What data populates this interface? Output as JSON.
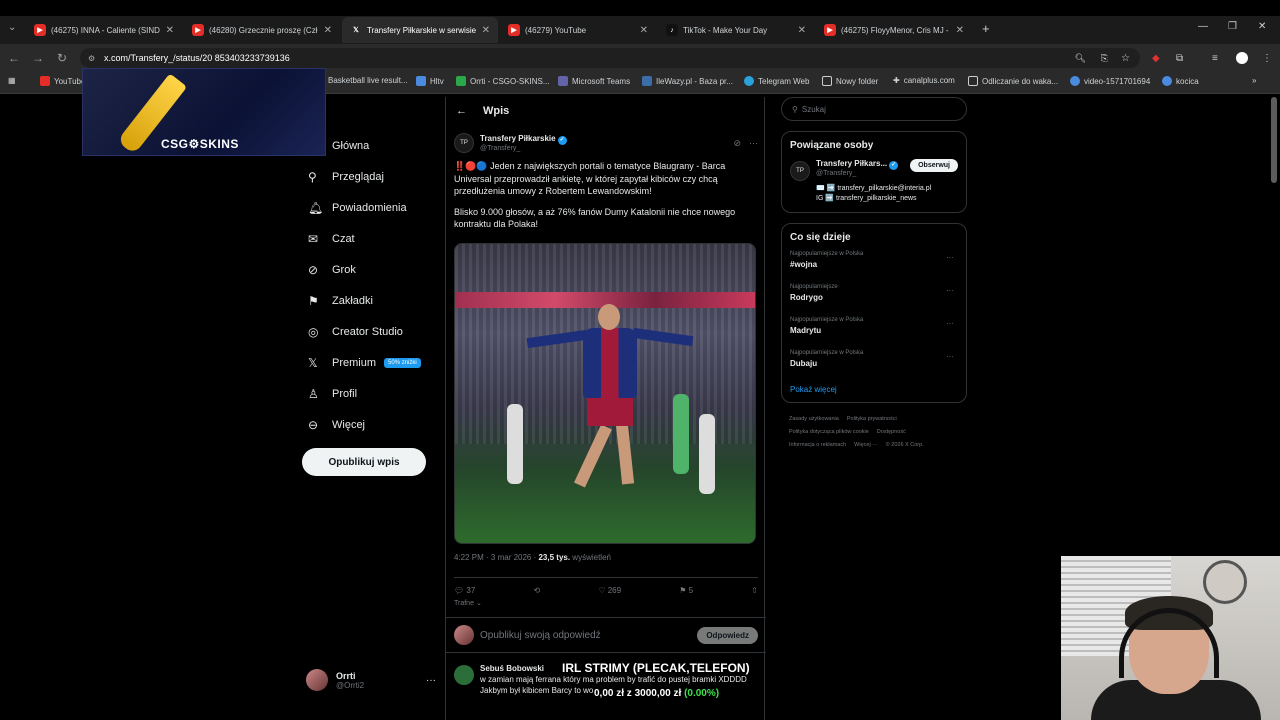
{
  "tabs": [
    {
      "title": "(46275) INNA - Caliente (SINDR",
      "icon": "youtube-icon"
    },
    {
      "title": "(46280) Grzecznie proszę (Człu",
      "icon": "youtube-icon"
    },
    {
      "title": "Transfery Piłkarskie w serwisie X",
      "icon": "x-icon"
    },
    {
      "title": "(46279) YouTube",
      "icon": "youtube-icon"
    },
    {
      "title": "TikTok - Make Your Day",
      "icon": "tiktok-icon"
    },
    {
      "title": "(46275) FloyyMenor, Cris MJ - G",
      "icon": "youtube-icon"
    }
  ],
  "url": "x.com/Transfery_/status/20     853403233739136",
  "bookmarks": [
    "YouTube",
    "Basketball live result...",
    "Hltv",
    "Orrti - CSGO-SKINS...",
    "Microsoft Teams",
    "IleWazy.pl - Baza pr...",
    "Telegram Web",
    "Nowy folder",
    "canalplus.com",
    "Odliczanie do waka...",
    "video-1571701694",
    "kocica"
  ],
  "csg_logo": "CSG⚙SKINS",
  "nav": {
    "items": [
      "Główna",
      "Przeglądaj",
      "Powiadomienia",
      "Czat",
      "Grok",
      "Zakładki",
      "Creator Studio",
      "Premium",
      "Profil",
      "Więcej"
    ],
    "premium_badge": "50% zniżki",
    "post_button": "Opublikuj wpis"
  },
  "user": {
    "name": "Orrti",
    "handle": "@Orrti2"
  },
  "header_title": "Wpis",
  "tweet": {
    "author": "Transfery Piłkarskie",
    "handle": "@Transfery_",
    "text1": "‼️🔴🔵 Jeden z największych portali o tematyce Blaugrany - Barca Universal przeprowadził ankietę, w której zapytał kibiców czy chcą przedłużenia umowy z Robertem Lewandowskim!",
    "text2": "Blisko 9.000 głosów, a aż 76% fanów Dumy Katalonii nie chce nowego kontraktu dla Polaka!",
    "time": "4:22 PM · 3 mar 2026 · ",
    "views": "23,5 tys.",
    "views_label": " wyświetleń",
    "replies": "37",
    "likes": "269",
    "bookmarks": "5",
    "sort": "Trafne"
  },
  "reply": {
    "placeholder": "Opublikuj swoją odpowiedź",
    "button": "Odpowiedz"
  },
  "comment": {
    "author": "Sebuś Bobowski",
    "line1": "w zamian mają ferrana który ma problem by trafić do pustej bramki XDDDD",
    "line2": "Jakbym był kibicem Barcy to wo"
  },
  "right": {
    "search_placeholder": "Szukaj",
    "related_title": "Powiązane osoby",
    "related_name": "Transfery Piłkars...",
    "related_handle": "@Transfery_",
    "follow": "Obserwuj",
    "related_line1": "✉️ ➡️ transfery_pilkarskie@interia.pl",
    "related_line2": "IG ➡️ transfery_pilkarskie_news",
    "trends_title": "Co się dzieje",
    "trends": [
      {
        "cat": "Najpopularniejsze w Polska",
        "title": "#wojna"
      },
      {
        "cat": "Najpopularniejsze",
        "title": "Rodrygo"
      },
      {
        "cat": "Najpopularniejsze w Polska",
        "title": "Madrytu"
      },
      {
        "cat": "Najpopularniejsze w Polska",
        "title": "Dubaju"
      }
    ],
    "show_more": "Pokaż więcej",
    "footer": [
      "Zasady użytkowania",
      "Polityka prywatności",
      "Polityka dotycząca plików cookie",
      "Dostępność",
      "Informacja o reklamach",
      "Więcej ···",
      "© 2026 X Corp."
    ]
  },
  "overlay": {
    "line1": "IRL STRIMY (PLECAK,TELEFON)",
    "line2a": "0,00 zł z 3000,00 zł ",
    "line2b": "(0.00%)"
  }
}
